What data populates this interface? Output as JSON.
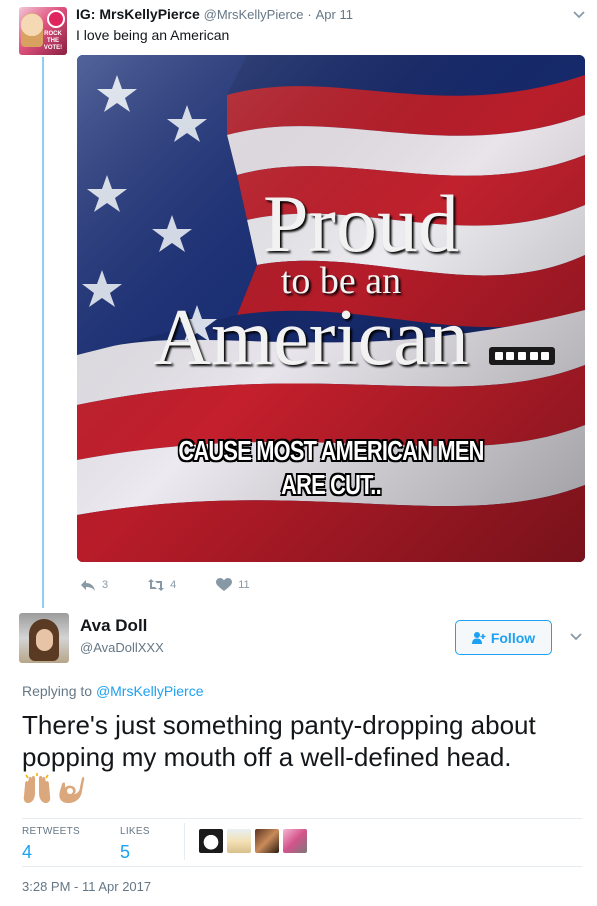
{
  "parent_tweet": {
    "display_name": "IG: MrsKellyPierce",
    "handle": "@MrsKellyPierce",
    "separator": "·",
    "date": "Apr 11",
    "text": "I love being an American",
    "avatar_text": "ROCK THE VOTE!",
    "media": {
      "line1": "Proud",
      "line2": "to be an",
      "line3": "American",
      "caption_line1": "CAUSE MOST AMERICAN MEN",
      "caption_line2": "ARE CUT.."
    },
    "actions": {
      "replies": "3",
      "retweets": "4",
      "likes": "11"
    },
    "menu_icon": "chevron-down-icon"
  },
  "reply_tweet": {
    "display_name": "Ava Doll",
    "handle": "@AvaDollXXX",
    "follow_label": "Follow",
    "replying_prefix": "Replying to",
    "replying_mention": "@MrsKellyPierce",
    "text": "There's just something panty-dropping about popping my mouth off a well-defined head.",
    "emojis": [
      "raised-hands-emoji",
      "ok-hand-emoji"
    ],
    "stats": {
      "retweets_label": "RETWEETS",
      "retweets_value": "4",
      "likes_label": "LIKES",
      "likes_value": "5"
    },
    "timestamp": "3:28 PM - 11 Apr 2017"
  },
  "colors": {
    "accent": "#1da1f2",
    "muted": "#657786",
    "thread_line": "#8ed0f4",
    "text": "#14171a",
    "divider": "#e6ecf0"
  }
}
